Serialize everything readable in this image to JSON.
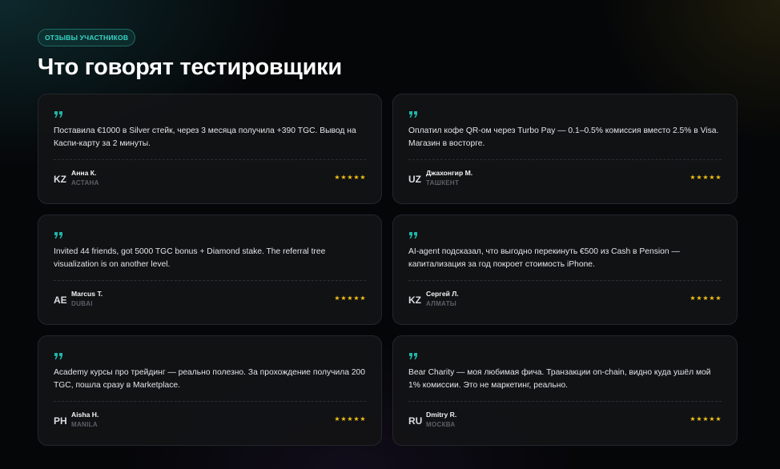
{
  "section": {
    "badge": "ОТЗЫВЫ УЧАСТНИКОВ",
    "title": "Что говорят тестировщики"
  },
  "colors": {
    "accent": "#39d6c8",
    "star": "#f5c518"
  },
  "icons": {
    "quote": "quote-icon",
    "star": "star-icon"
  },
  "reviews": [
    {
      "text": "Поставила €1000 в Silver стейк, через 3 месяца получила +390 TGC. Вывод на Каспи-карту за 2 минуты.",
      "code": "KZ",
      "name": "Анна К.",
      "city": "АСТАНА",
      "rating": 5
    },
    {
      "text": "Оплатил кофе QR-ом через Turbo Pay — 0.1–0.5% комиссия вместо 2.5% в Visa. Магазин в восторге.",
      "code": "UZ",
      "name": "Джахонгир М.",
      "city": "ТАШКЕНТ",
      "rating": 5
    },
    {
      "text": "Invited 44 friends, got 5000 TGC bonus + Diamond stake. The referral tree visualization is on another level.",
      "code": "AE",
      "name": "Marcus T.",
      "city": "DUBAI",
      "rating": 5
    },
    {
      "text": "AI-agent подсказал, что выгодно перекинуть €500 из Cash в Pension — капитализация за год покроет стоимость iPhone.",
      "code": "KZ",
      "name": "Сергей Л.",
      "city": "АЛМАТЫ",
      "rating": 5
    },
    {
      "text": "Academy курсы про трейдинг — реально полезно. За прохождение получила 200 TGC, пошла сразу в Marketplace.",
      "code": "PH",
      "name": "Aisha H.",
      "city": "MANILA",
      "rating": 5
    },
    {
      "text": "Bear Charity — моя любимая фича. Транзакции on-chain, видно куда ушёл мой 1% комиссии. Это не маркетинг, реально.",
      "code": "RU",
      "name": "Dmitry R.",
      "city": "МОСКВА",
      "rating": 5
    }
  ]
}
